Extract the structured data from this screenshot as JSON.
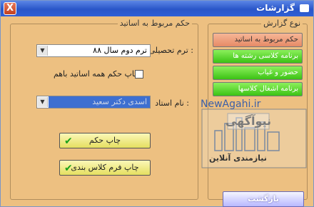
{
  "window": {
    "title": "گزارشات",
    "close_glyph": "X"
  },
  "report_types": {
    "legend": "نوع گزارش",
    "items": [
      {
        "label": "حکم مربوط به اساتید",
        "style": "orange"
      },
      {
        "label": "برنامه کلاسی رشته ها",
        "style": "green"
      },
      {
        "label": "حضور و غیاب",
        "style": "green"
      },
      {
        "label": "برنامه اشغال کلاسها",
        "style": "green"
      }
    ]
  },
  "teacher_ruling": {
    "legend": "حکم مربوط به اساتید",
    "semester_label": "ترم تحصیلی :",
    "semester_value": "ترم دوم  سال ۸۸",
    "print_all_label": "چاپ حکم همه اساتید باهم",
    "teacher_label": "نام استاد :",
    "teacher_value": "اسدی دکتر سعید",
    "print_ruling_button": "چاپ حکم",
    "print_class_schedule_button": "چاپ فرم کلاس بندی"
  },
  "return_button": "بازگشت",
  "watermark": {
    "site": "NewAgahi.ir",
    "brand": "نیوآگهی",
    "tagline": "نیازمندی آنلاین"
  },
  "colors": {
    "window_bg": "#edc081",
    "title_bar": "#2a55c8",
    "green_button": "#3bc214",
    "orange_button": "#e68a66",
    "yellow_button": "#e5df60",
    "combo_highlight": "#3d6fd1"
  }
}
